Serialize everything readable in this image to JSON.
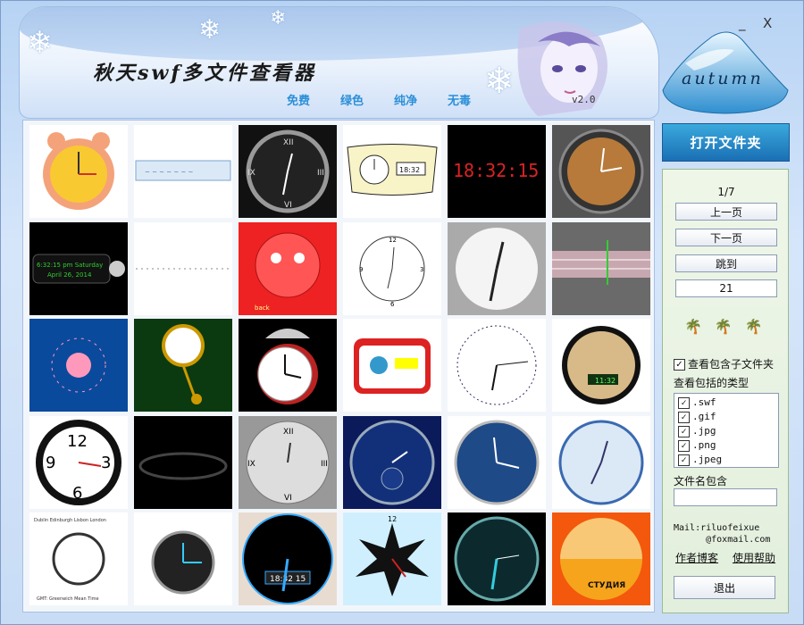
{
  "header": {
    "title": "秋天swf多文件查看器",
    "tags": [
      "免费",
      "绿色",
      "纯净",
      "无毒"
    ],
    "version": "v2.0",
    "logo_text": "autumn",
    "minimize_label": "_",
    "close_label": "X"
  },
  "panel": {
    "open_folder_label": "打开文件夹",
    "page_indicator": "1/7",
    "prev_label": "上一页",
    "next_label": "下一页",
    "jump_label": "跳到",
    "jump_value": "21",
    "include_subfolders_label": "查看包含子文件夹",
    "include_subfolders_checked": true,
    "types_label": "查看包括的类型",
    "types": [
      {
        "ext": ".swf",
        "checked": true
      },
      {
        "ext": ".gif",
        "checked": true
      },
      {
        "ext": ".jpg",
        "checked": true
      },
      {
        "ext": ".png",
        "checked": true
      },
      {
        "ext": ".jpeg",
        "checked": true
      }
    ],
    "filename_label": "文件名包含",
    "filename_value": "",
    "mail_line1": "Mail:riluofeixue",
    "mail_line2": "@foxmail.com",
    "blog_link": "作者博客",
    "help_link": "使用帮助",
    "exit_label": "退出"
  },
  "thumbs": {
    "t5": "18:32:15",
    "t6": "6:32:15 pm Saturday",
    "t6b": "April 26, 2014",
    "t4": "18:32",
    "t17": "11:32",
    "t22_top": "Dublin Edinburgh Lisbon London",
    "t22_bottom": "GMT: Greenwich Mean Time",
    "t24": "18:32 15",
    "t26": "СТУДИЯ",
    "t8_back": "back"
  },
  "colors": {
    "accent": "#1a6fb4",
    "tag": "#2b8fd8"
  }
}
